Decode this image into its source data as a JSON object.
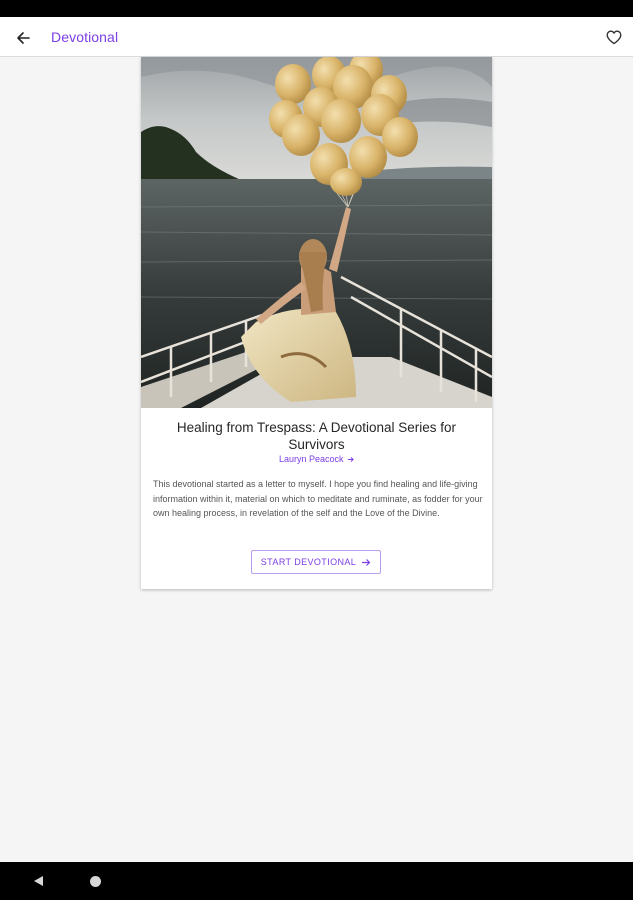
{
  "app_bar": {
    "title": "Devotional",
    "back_icon": "arrow-left-icon",
    "favorite_icon": "heart-outline-icon"
  },
  "devotional": {
    "image_description": "woman on boat deck holding balloons over the sea",
    "title": "Healing from Trespass: A Devotional Series for Survivors",
    "author": "Lauryn Peacock",
    "author_icon": "arrow-right-icon",
    "description": "This devotional started as a letter to myself. I hope you find healing and life-giving information within it, material on which to meditate and ruminate, as fodder for your own healing process, in revelation of the self and the Love of the Divine.",
    "start_button_label": "START DEVOTIONAL",
    "start_button_icon": "arrow-right-icon"
  },
  "colors": {
    "accent": "#7b3fe4",
    "background": "#f5f5f5",
    "card": "#ffffff"
  },
  "system_nav": {
    "back_icon": "triangle-back-icon",
    "home_icon": "circle-home-icon"
  }
}
